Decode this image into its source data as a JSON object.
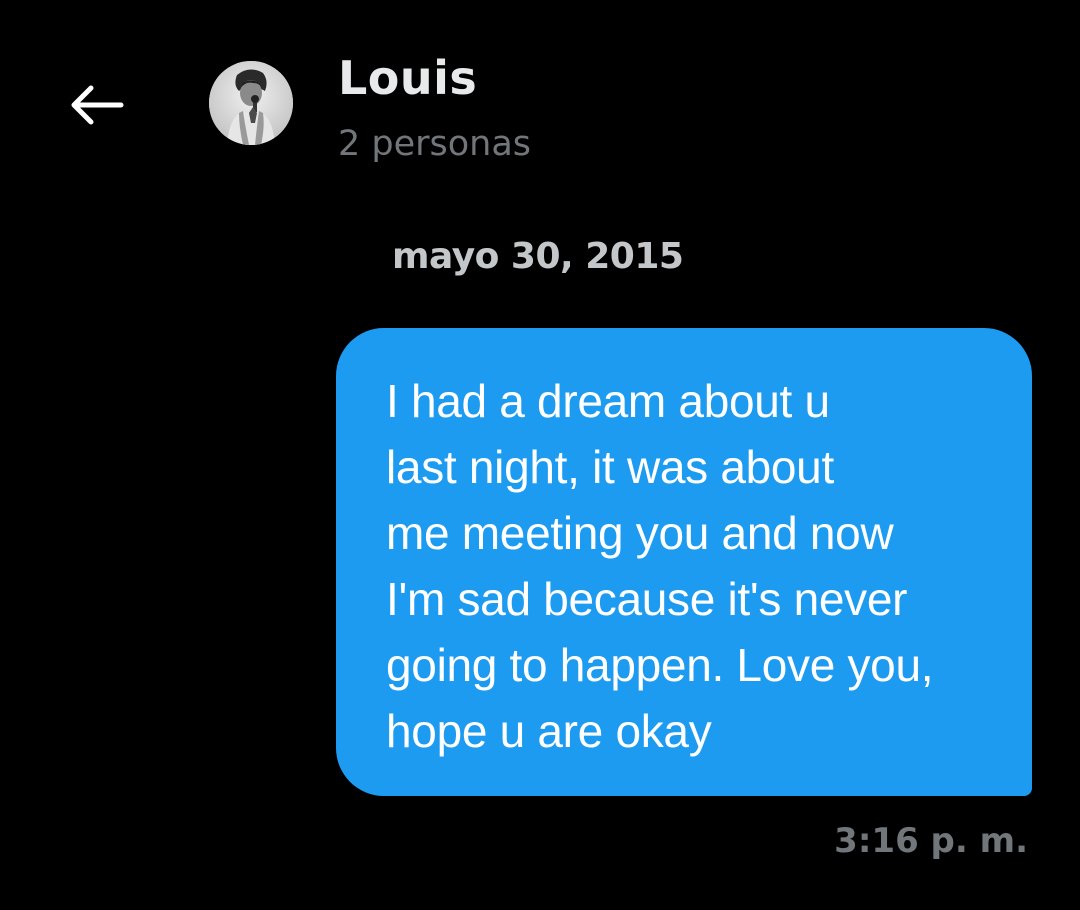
{
  "header": {
    "back_icon": "arrow-left-icon",
    "title": "Louis",
    "subtitle": "2 personas",
    "avatar_icon": "avatar-photo"
  },
  "conversation": {
    "date_label": "mayo 30, 2015",
    "messages": [
      {
        "direction": "sent",
        "text": "I had a dream about u\nlast night, it was about\nme meeting you and now\nI'm sad because it's never\ngoing to happen. Love you,\nhope u are okay",
        "time": "3:16 p. m."
      }
    ]
  },
  "colors": {
    "background": "#000000",
    "bubble": "#1d9bf0",
    "primary_text": "#e7e9ea",
    "secondary_text": "#71767b"
  }
}
